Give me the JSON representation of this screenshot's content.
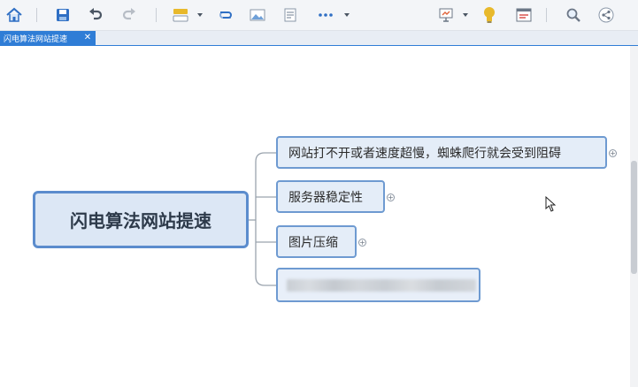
{
  "tab": {
    "label": "闪电算法网站提速",
    "close": "✕"
  },
  "mindmap": {
    "central": "闪电算法网站提速",
    "children": [
      {
        "text": "网站打不开或者速度超慢，蜘蛛爬行就会受到阻碍",
        "expander": "+"
      },
      {
        "text": "服务器稳定性",
        "expander": "+"
      },
      {
        "text": "图片压缩",
        "expander": "+"
      },
      {
        "text": "",
        "expander": ""
      }
    ]
  },
  "colors": {
    "accent": "#2f7dd6",
    "node_border": "#6e9ad1",
    "node_fill": "#e4edf8",
    "icon_blue": "#2f6fc4",
    "icon_yellow": "#e8b92c"
  },
  "icons": [
    "home-icon",
    "save-icon",
    "undo-icon",
    "redo-icon",
    "theme-icon",
    "dropdown-arrow-icon",
    "link-icon",
    "image-icon",
    "note-icon",
    "more-icon",
    "presentation-icon",
    "lightbulb-icon",
    "outline-icon",
    "search-icon",
    "share-icon"
  ]
}
